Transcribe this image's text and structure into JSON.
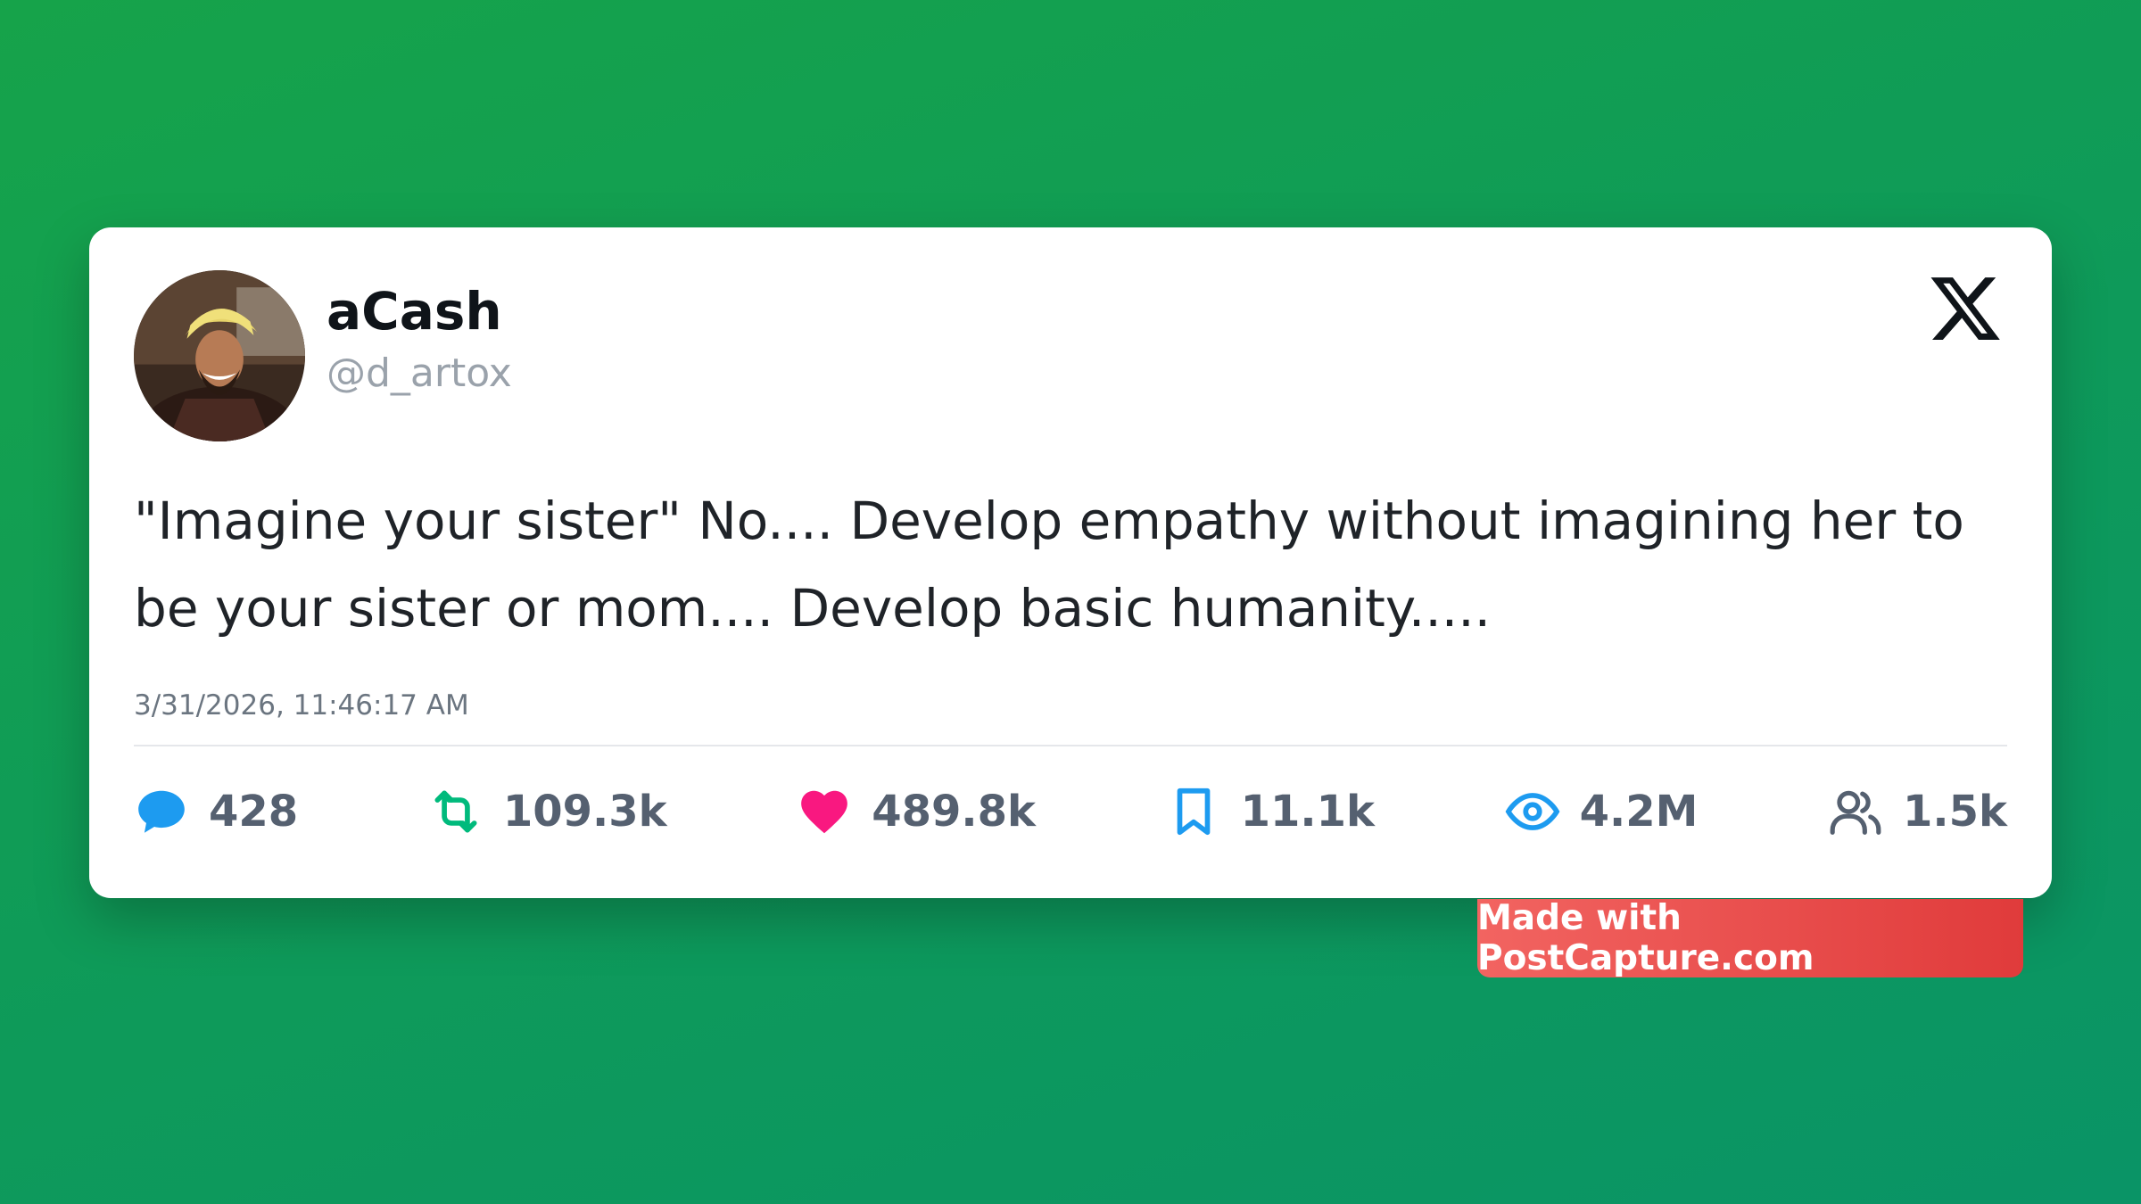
{
  "post": {
    "display_name": "aCash",
    "handle": "@d_artox",
    "text": "\"Imagine your sister\" No.... Develop empathy without imagining her to be your sister or mom.... Develop basic humanity.....",
    "timestamp": "3/31/2026, 11:46:17 AM"
  },
  "stats": {
    "replies": "428",
    "reposts": "109.3k",
    "likes": "489.8k",
    "bookmarks": "11.1k",
    "views": "4.2M",
    "followers": "1.5k"
  },
  "watermark": "Made with PostCapture.com",
  "colors": {
    "background": "#16a34a",
    "reply": "#1d9bf0",
    "repost": "#00ba7c",
    "like": "#f91880",
    "bookmark": "#1d9bf0",
    "views": "#1d9bf0",
    "followers": "#556070",
    "watermark": "#e8504e"
  },
  "icons": {
    "reply": "speech-bubble-icon",
    "repost": "repost-arrows-icon",
    "like": "heart-icon",
    "bookmark": "bookmark-icon",
    "views": "eye-icon",
    "followers": "users-icon",
    "brand": "x-logo-icon"
  }
}
